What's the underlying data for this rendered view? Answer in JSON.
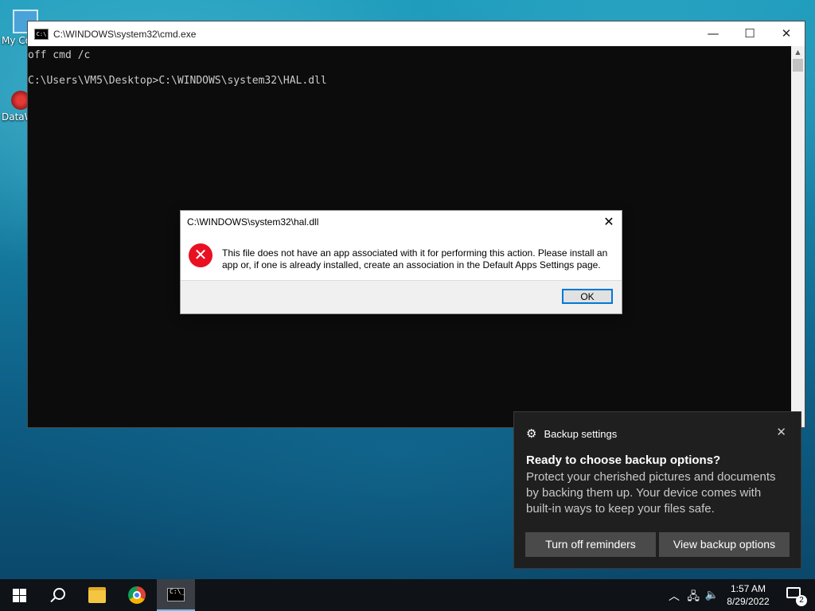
{
  "desktop": {
    "icons": [
      {
        "label": "My Co",
        "icon": "this-pc-icon"
      },
      {
        "label": "DataW",
        "icon": "datawrapper-shortcut-icon"
      }
    ]
  },
  "cmd_window": {
    "title": "C:\\WINDOWS\\system32\\cmd.exe",
    "lines": [
      "off cmd /c",
      "",
      "C:\\Users\\VM5\\Desktop>C:\\WINDOWS\\system32\\HAL.dll"
    ],
    "controls": {
      "minimize": "—",
      "maximize": "☐",
      "close": "✕"
    },
    "background": "#0c0c0c",
    "text_color": "#cccccc"
  },
  "dialog": {
    "title": "C:\\WINDOWS\\system32\\hal.dll",
    "message": "This file does not have an app associated with it for performing this action. Please install an app or, if one is already installed, create an association in the Default Apps Settings page.",
    "ok_label": "OK",
    "close_glyph": "✕",
    "icon": "error-icon",
    "icon_color": "#e81123"
  },
  "toast": {
    "app_name": "Backup settings",
    "heading": "Ready to choose backup options?",
    "body": "Protect your cherished pictures and documents by backing them up. Your device comes with built-in ways to keep your files safe.",
    "buttons": [
      "Turn off reminders",
      "View backup options"
    ],
    "close_glyph": "✕"
  },
  "taskbar": {
    "items": [
      "start-button",
      "search-button",
      "file-explorer",
      "chrome",
      "command-prompt"
    ],
    "active": "command-prompt",
    "time": "1:57 AM",
    "date": "8/29/2022",
    "notification_count": "2",
    "accent": "#76b9ed"
  }
}
